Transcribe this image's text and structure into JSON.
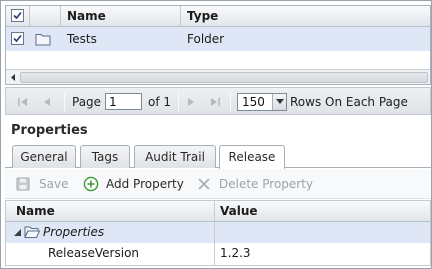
{
  "grid": {
    "columns": [
      "Name",
      "Type"
    ],
    "rows": [
      {
        "name": "Tests",
        "type": "Folder",
        "checked": true
      }
    ],
    "header_checked": true
  },
  "pager": {
    "page_label": "Page",
    "page_value": "1",
    "of_label": "of 1",
    "rows_value": "150",
    "rows_label": "Rows On Each Page"
  },
  "properties": {
    "title": "Properties",
    "tabs": [
      "General",
      "Tags",
      "Audit Trail",
      "Release"
    ],
    "active_tab": "Release",
    "toolbar": {
      "save_label": "Save",
      "add_label": "Add Property",
      "delete_label": "Delete Property"
    },
    "columns": [
      "Name",
      "Value"
    ],
    "group_label": "Properties",
    "items": [
      {
        "name": "ReleaseVersion",
        "value": "1.2.3"
      }
    ]
  },
  "colors": {
    "selected_row": "#dfe6f5",
    "add_icon": "#3a9a3a",
    "folder_icon": "#5a6f8a"
  }
}
